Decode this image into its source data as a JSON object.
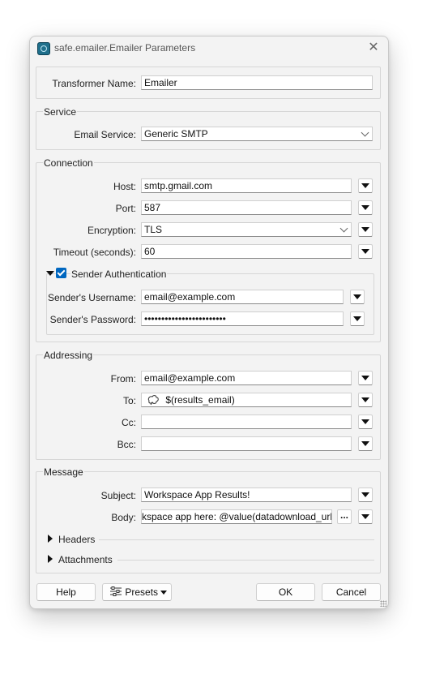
{
  "window": {
    "title": "safe.emailer.Emailer Parameters",
    "close_glyph": "✕"
  },
  "transformer": {
    "label": "Transformer Name:",
    "value": "Emailer"
  },
  "service": {
    "group_label": "Service",
    "email_service_label": "Email Service:",
    "email_service_value": "Generic SMTP"
  },
  "connection": {
    "group_label": "Connection",
    "host_label": "Host:",
    "host_value": "smtp.gmail.com",
    "port_label": "Port:",
    "port_value": "587",
    "encryption_label": "Encryption:",
    "encryption_value": "TLS",
    "timeout_label": "Timeout (seconds):",
    "timeout_value": "60",
    "auth": {
      "label": "Sender Authentication",
      "checked": true,
      "username_label": "Sender's Username:",
      "username_value": "email@example.com",
      "password_label": "Sender's Password:",
      "password_value": "••••••••••••••••••••••••"
    }
  },
  "addressing": {
    "group_label": "Addressing",
    "from_label": "From:",
    "from_value": "email@example.com",
    "to_label": "To:",
    "to_value": "$(results_email)",
    "cc_label": "Cc:",
    "cc_value": "",
    "bcc_label": "Bcc:",
    "bcc_value": ""
  },
  "message": {
    "group_label": "Message",
    "subject_label": "Subject:",
    "subject_value": "Workspace App Results!",
    "body_label": "Body:",
    "body_value": "kspace app here: @value(datadownload_url)",
    "body_button": "...",
    "headers_label": "Headers",
    "attachments_label": "Attachments"
  },
  "footer": {
    "help": "Help",
    "presets": "Presets",
    "ok": "OK",
    "cancel": "Cancel"
  },
  "colors": {
    "accent": "#0067c0",
    "dialog_bg": "#f3f3f3",
    "field_bg": "#ffffff"
  },
  "icons": {
    "app": "app-icon",
    "close": "close-icon",
    "param": "parameter-icon",
    "presets": "presets-icon"
  }
}
